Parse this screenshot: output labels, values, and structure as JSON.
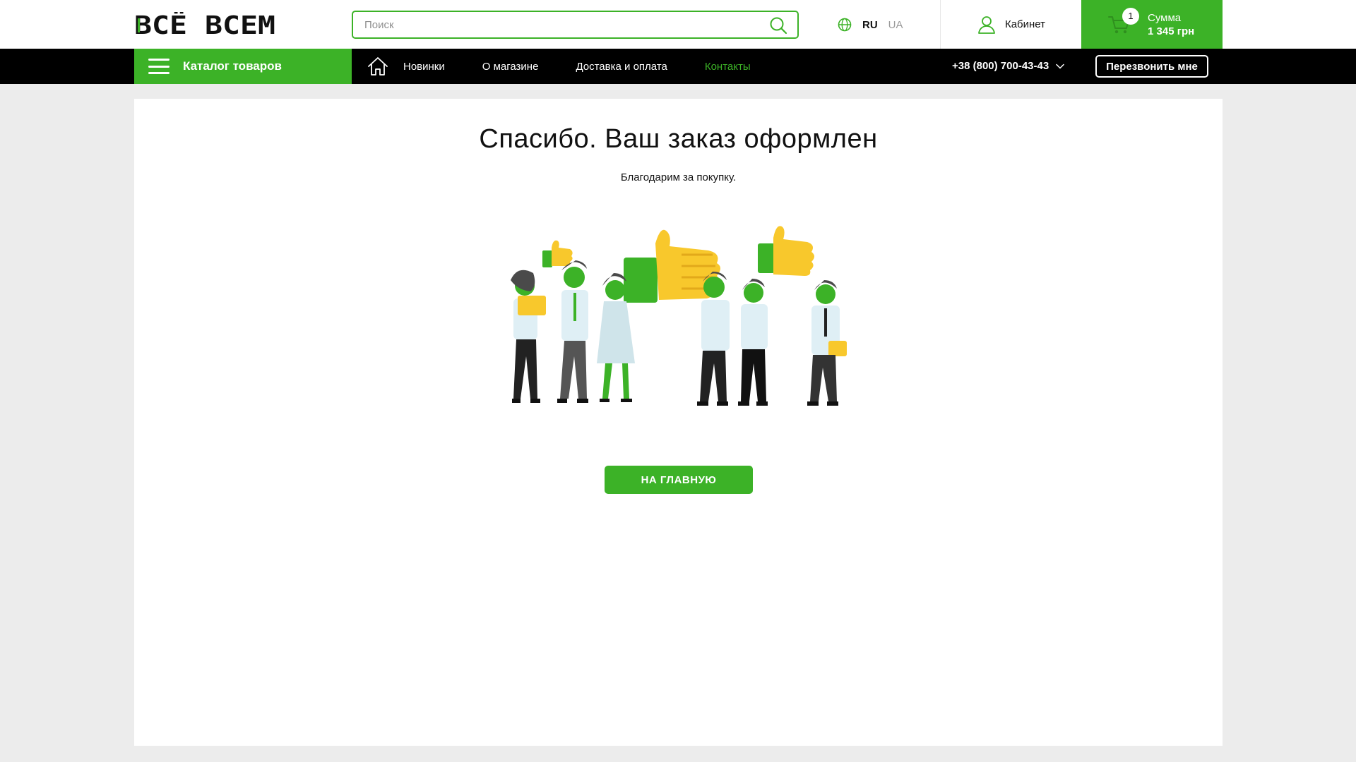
{
  "header": {
    "logo_text": "ВСЁ ВСЕМ",
    "search": {
      "placeholder": "Поиск",
      "value": ""
    },
    "languages": [
      {
        "code": "RU",
        "active": true
      },
      {
        "code": "UA",
        "active": false
      }
    ],
    "cabinet_label": "Кабинет",
    "cart": {
      "count": "1",
      "sum_label": "Сумма",
      "sum_value": "1 345 грн"
    }
  },
  "nav": {
    "catalog_label": "Каталог товаров",
    "links": [
      {
        "label": "Новинки",
        "active": false
      },
      {
        "label": "О магазине",
        "active": false
      },
      {
        "label": "Доставка и оплата",
        "active": false
      },
      {
        "label": "Контакты",
        "active": true
      }
    ],
    "phone": "+38 (800) 700-43-43",
    "callback_label": "Перезвонить мне"
  },
  "main": {
    "title": "Спасибо. Ваш заказ оформлен",
    "subtitle": "Благодарим за покупку.",
    "home_button_label": "НА ГЛАВНУЮ"
  },
  "colors": {
    "accent": "#3cb227",
    "nav_bg": "#000000",
    "page_bg": "#ececec",
    "thumb_yellow": "#f8c82c"
  },
  "icons": [
    "search-icon",
    "globe-icon",
    "user-icon",
    "cart-icon",
    "menu-icon",
    "home-icon",
    "chevron-down-icon"
  ]
}
